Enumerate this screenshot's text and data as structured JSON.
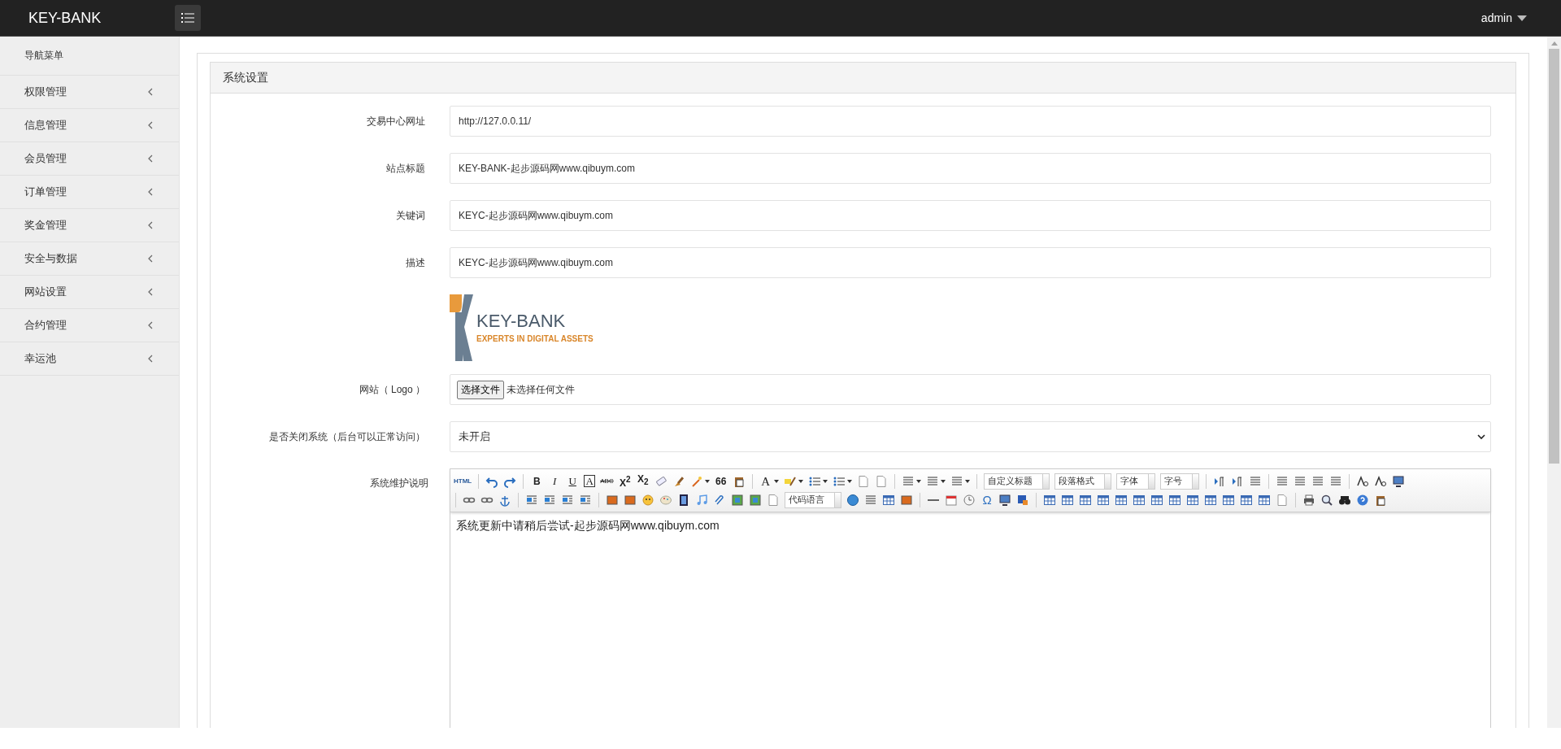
{
  "header": {
    "brand": "KEY-BANK",
    "user": "admin"
  },
  "sidebar": {
    "title": "导航菜单",
    "items": [
      {
        "label": "权限管理",
        "expanded": false
      },
      {
        "label": "信息管理",
        "expanded": false
      },
      {
        "label": "会员管理",
        "expanded": false
      },
      {
        "label": "订单管理",
        "expanded": false
      },
      {
        "label": "奖金管理",
        "expanded": false
      },
      {
        "label": "安全与数据",
        "expanded": false
      },
      {
        "label": "网站设置",
        "expanded": false
      },
      {
        "label": "合约管理",
        "expanded": false
      },
      {
        "label": "幸运池",
        "expanded": false
      }
    ]
  },
  "panel": {
    "title": "系统设置",
    "fields": [
      {
        "kind": "text",
        "label": "交易中心网址",
        "value": "http://127.0.0.11/"
      },
      {
        "kind": "text",
        "label": "站点标题",
        "value": "KEY-BANK-起步源码网www.qibuym.com"
      },
      {
        "kind": "text",
        "label": "关键词",
        "value": "KEYC-起步源码网www.qibuym.com"
      },
      {
        "kind": "text",
        "label": "描述",
        "value": "KEYC-起步源码网www.qibuym.com"
      },
      {
        "kind": "logo",
        "title": "KEY-BANK",
        "tagline": "EXPERTS IN DIGITAL ASSETS"
      },
      {
        "kind": "file",
        "label": "网站（ Logo ）",
        "button": "选择文件",
        "status": "未选择任何文件"
      },
      {
        "kind": "select",
        "label": "是否关闭系统（后台可以正常访问）",
        "value": "未开启"
      },
      {
        "kind": "editor",
        "label": "系统维护说明",
        "content": "系统更新中请稍后尝试-起步源码网www.qibuym.com"
      }
    ]
  },
  "toolbar": {
    "rows": [
      [
        {
          "kind": "glyph",
          "text": "HTML"
        },
        {
          "kind": "sep"
        },
        {
          "kind": "icon"
        },
        {
          "kind": "icon"
        },
        {
          "kind": "sep"
        },
        {
          "kind": "glyph",
          "text": "B"
        },
        {
          "kind": "glyph",
          "text": "I"
        },
        {
          "kind": "glyph",
          "text": "U"
        },
        {
          "kind": "glyph",
          "text": "A"
        },
        {
          "kind": "glyph",
          "text": "ABC"
        },
        {
          "kind": "glyph",
          "text": "X$^{2}$"
        },
        {
          "kind": "glyph",
          "text": "X$_{2}$"
        },
        {
          "kind": "icon"
        },
        {
          "kind": "icon"
        },
        {
          "kind": "icon"
        },
        {
          "kind": "glyph",
          "text": "66"
        },
        {
          "kind": "icon"
        },
        {
          "kind": "sep"
        },
        {
          "kind": "glyph",
          "text": "A"
        },
        {
          "kind": "icon"
        },
        {
          "kind": "icon"
        },
        {
          "kind": "icon"
        },
        {
          "kind": "icon"
        },
        {
          "kind": "icon"
        },
        {
          "kind": "sep"
        },
        {
          "kind": "icon"
        },
        {
          "kind": "icon"
        },
        {
          "kind": "icon"
        },
        {
          "kind": "sep"
        },
        {
          "kind": "select",
          "text": "自定义标题"
        },
        {
          "kind": "select",
          "text": "段落格式"
        },
        {
          "kind": "select",
          "text": "字体"
        },
        {
          "kind": "select",
          "text": "字号"
        },
        {
          "kind": "sep"
        },
        {
          "kind": "icon"
        },
        {
          "kind": "icon"
        },
        {
          "kind": "icon"
        },
        {
          "kind": "sep"
        },
        {
          "kind": "icon"
        },
        {
          "kind": "icon"
        },
        {
          "kind": "icon"
        },
        {
          "kind": "icon"
        },
        {
          "kind": "sep"
        },
        {
          "kind": "icon"
        },
        {
          "kind": "icon"
        },
        {
          "kind": "icon"
        }
      ],
      [
        {
          "kind": "sep"
        },
        {
          "kind": "icon"
        },
        {
          "kind": "icon"
        },
        {
          "kind": "icon"
        },
        {
          "kind": "sep"
        },
        {
          "kind": "icon"
        },
        {
          "kind": "icon"
        },
        {
          "kind": "icon"
        },
        {
          "kind": "icon"
        },
        {
          "kind": "sep"
        },
        {
          "kind": "icon"
        },
        {
          "kind": "icon"
        },
        {
          "kind": "icon"
        },
        {
          "kind": "icon"
        },
        {
          "kind": "icon"
        },
        {
          "kind": "icon"
        },
        {
          "kind": "icon"
        },
        {
          "kind": "icon"
        },
        {
          "kind": "icon"
        },
        {
          "kind": "icon"
        },
        {
          "kind": "select",
          "text": "代码语言"
        },
        {
          "kind": "icon"
        },
        {
          "kind": "icon"
        },
        {
          "kind": "icon"
        },
        {
          "kind": "icon"
        },
        {
          "kind": "sep"
        },
        {
          "kind": "icon"
        },
        {
          "kind": "icon"
        },
        {
          "kind": "icon"
        },
        {
          "kind": "glyph",
          "text": "Ω"
        },
        {
          "kind": "icon"
        },
        {
          "kind": "icon"
        },
        {
          "kind": "sep"
        },
        {
          "kind": "icon"
        },
        {
          "kind": "icon"
        },
        {
          "kind": "icon"
        },
        {
          "kind": "icon"
        },
        {
          "kind": "icon"
        },
        {
          "kind": "icon"
        },
        {
          "kind": "icon"
        },
        {
          "kind": "icon"
        },
        {
          "kind": "icon"
        },
        {
          "kind": "icon"
        },
        {
          "kind": "icon"
        },
        {
          "kind": "icon"
        },
        {
          "kind": "icon"
        },
        {
          "kind": "icon"
        },
        {
          "kind": "sep"
        },
        {
          "kind": "icon"
        },
        {
          "kind": "icon"
        },
        {
          "kind": "icon"
        },
        {
          "kind": "icon"
        },
        {
          "kind": "icon"
        }
      ]
    ]
  }
}
